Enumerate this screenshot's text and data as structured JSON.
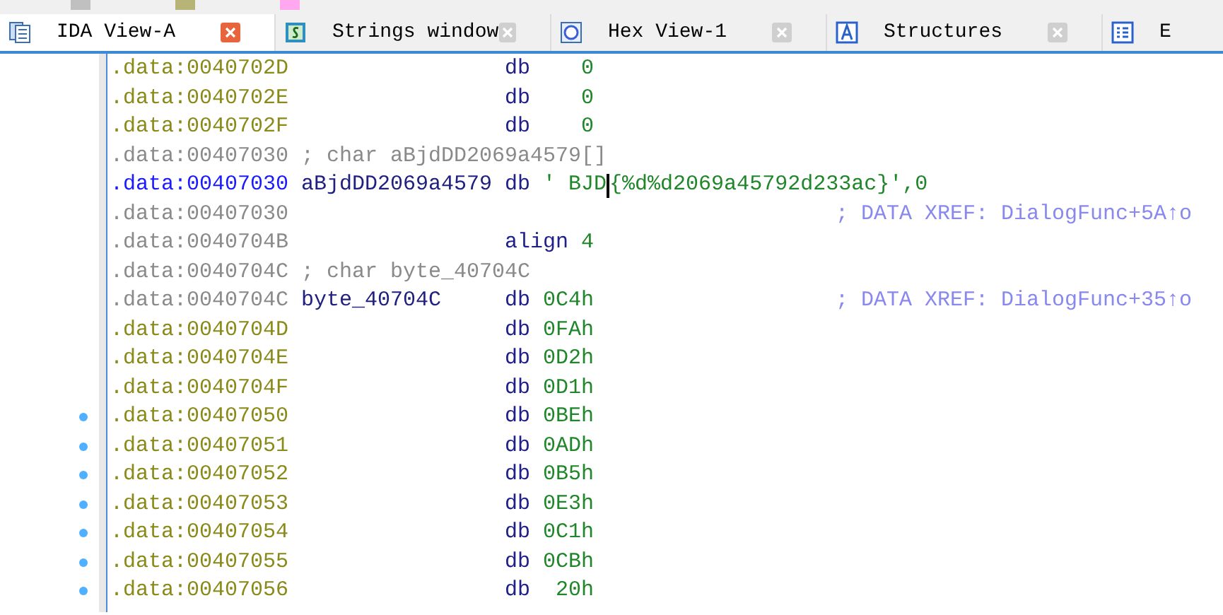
{
  "legend": [
    {
      "color": "#c0c0c0"
    },
    {
      "color": "#b8b478"
    },
    {
      "color": "#ffa8f0"
    }
  ],
  "tabs": [
    {
      "label": "IDA View-A",
      "selected": true,
      "closable": true
    },
    {
      "label": "Strings window",
      "selected": false,
      "closable": true
    },
    {
      "label": "Hex View-1",
      "selected": false,
      "closable": true
    },
    {
      "label": "Structures",
      "selected": false,
      "closable": true
    },
    {
      "label": "E",
      "selected": false,
      "closable": false
    }
  ],
  "lines": [
    {
      "kind": "data",
      "address": ".data:0040702D",
      "op": "db",
      "operand": "0",
      "bullet": false
    },
    {
      "kind": "data",
      "address": ".data:0040702E",
      "op": "db",
      "operand": "0",
      "bullet": false
    },
    {
      "kind": "data",
      "address": ".data:0040702F",
      "op": "db",
      "operand": "0",
      "bullet": false
    },
    {
      "kind": "note",
      "address": ".data:00407030",
      "comment": "; char aBjdDD2069a4579[]",
      "bullet": false
    },
    {
      "kind": "current",
      "address": ".data:00407030",
      "label": "aBjdDD2069a4579",
      "op": "db",
      "operand": "' BJD",
      "operand_rest": "{%d%d2069a45792d233ac}',0",
      "bullet": false
    },
    {
      "kind": "xref",
      "address": ".data:00407030",
      "xref": "; DATA XREF: DialogFunc+5A↑o",
      "bullet": false
    },
    {
      "kind": "dim",
      "address": ".data:0040704B",
      "op": "align",
      "operand": "4",
      "bullet": false
    },
    {
      "kind": "note",
      "address": ".data:0040704C",
      "comment": "; char byte_40704C",
      "bullet": false
    },
    {
      "kind": "dim",
      "address": ".data:0040704C",
      "label": "byte_40704C",
      "op": "db",
      "operand": "0C4h",
      "xref": "; DATA XREF: DialogFunc+35↑o",
      "bullet": false
    },
    {
      "kind": "data",
      "address": ".data:0040704D",
      "op": "db",
      "operand": "0FAh",
      "bullet": false
    },
    {
      "kind": "data",
      "address": ".data:0040704E",
      "op": "db",
      "operand": "0D2h",
      "bullet": false
    },
    {
      "kind": "data",
      "address": ".data:0040704F",
      "op": "db",
      "operand": "0D1h",
      "bullet": false
    },
    {
      "kind": "data",
      "address": ".data:00407050",
      "op": "db",
      "operand": "0BEh",
      "bullet": true
    },
    {
      "kind": "data",
      "address": ".data:00407051",
      "op": "db",
      "operand": "0ADh",
      "bullet": true
    },
    {
      "kind": "data",
      "address": ".data:00407052",
      "op": "db",
      "operand": "0B5h",
      "bullet": true
    },
    {
      "kind": "data",
      "address": ".data:00407053",
      "op": "db",
      "operand": "0E3h",
      "bullet": true
    },
    {
      "kind": "data",
      "address": ".data:00407054",
      "op": "db",
      "operand": "0C1h",
      "bullet": true
    },
    {
      "kind": "data",
      "address": ".data:00407055",
      "op": "db",
      "operand": "0CBh",
      "bullet": true
    },
    {
      "kind": "data",
      "address": ".data:00407056",
      "op": "db",
      "operand": "20h",
      "bullet": true
    }
  ]
}
